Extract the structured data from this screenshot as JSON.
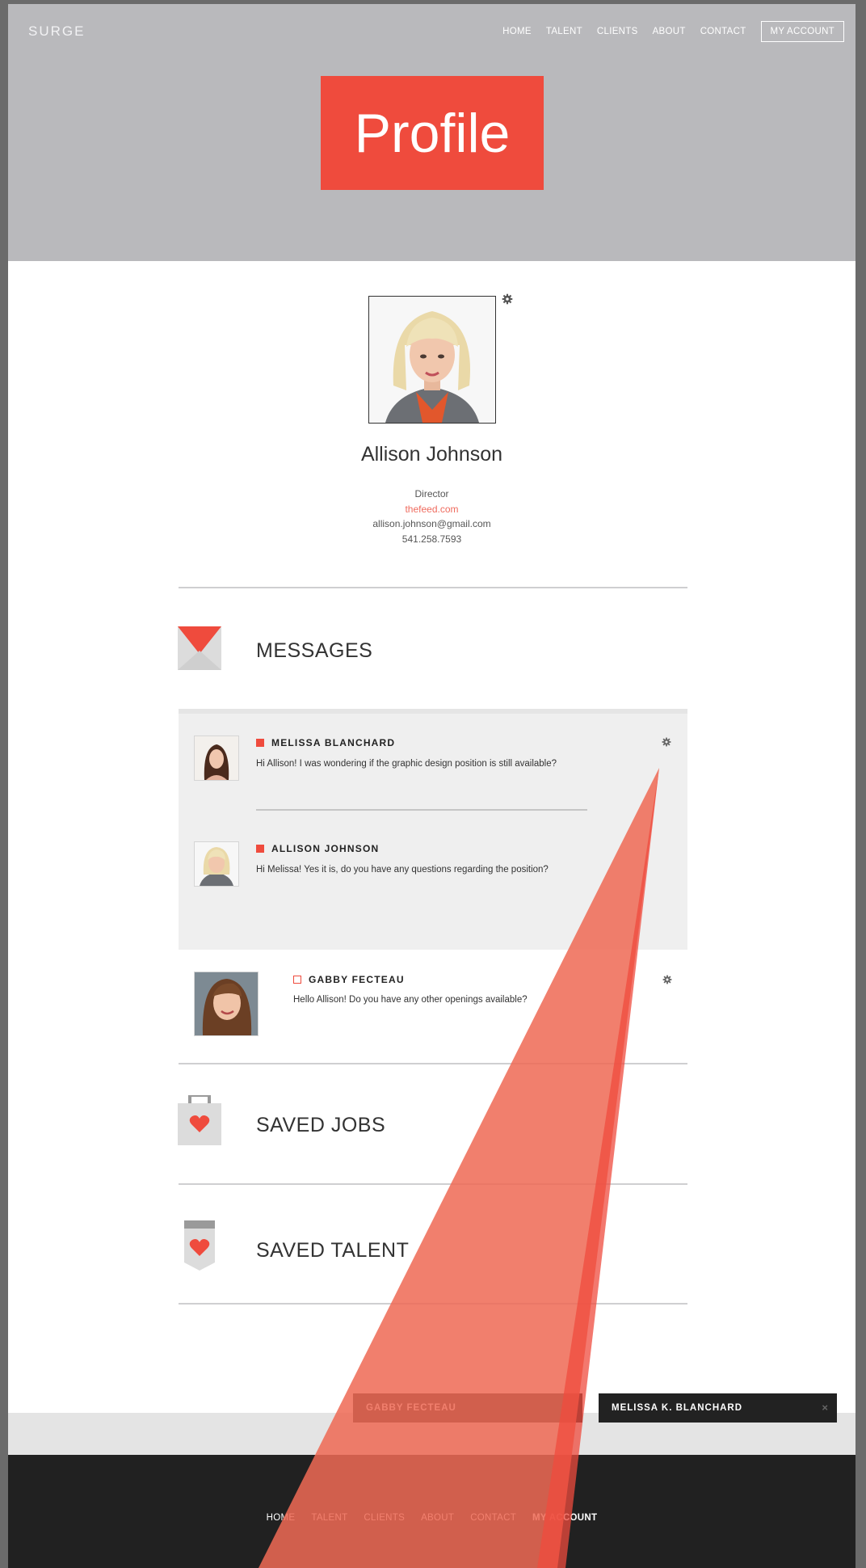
{
  "brand": "SURGE",
  "nav": {
    "items": [
      {
        "label": "HOME"
      },
      {
        "label": "TALENT"
      },
      {
        "label": "CLIENTS"
      },
      {
        "label": "ABOUT"
      },
      {
        "label": "CONTACT"
      }
    ],
    "account": "MY ACCOUNT"
  },
  "banner": "Profile",
  "profile": {
    "name": "Allison Johnson",
    "title": "Director",
    "website": "thefeed.com",
    "email": "allison.johnson@gmail.com",
    "phone": "541.258.7593"
  },
  "sections": {
    "messages": "MESSAGES",
    "saved_jobs": "SAVED JOBS",
    "saved_talent": "SAVED TALENT"
  },
  "messages": {
    "thread1": {
      "first": {
        "sender": "MELISSA BLANCHARD",
        "text": "Hi Allison! I was wondering if the graphic design position is still available?"
      },
      "reply": {
        "sender": "ALLISON JOHNSON",
        "text": "Hi Melissa! Yes it is, do you have any questions regarding the position?"
      }
    },
    "thread2": {
      "sender": "GABBY FECTEAU",
      "text": "Hello Allison! Do you have any other openings available?"
    }
  },
  "chat": {
    "tab1": "GABBY FECTEAU",
    "tab2": "MELISSA K. BLANCHARD",
    "close": "×"
  },
  "footer": {
    "items": [
      {
        "label": "HOME"
      },
      {
        "label": "TALENT"
      },
      {
        "label": "CLIENTS"
      },
      {
        "label": "ABOUT"
      },
      {
        "label": "CONTACT"
      }
    ],
    "account": "MY ACCOUNT"
  },
  "colors": {
    "accent": "#ef4b3d",
    "header_bg": "#b9b9bc",
    "footer_bg": "#212121",
    "thread_bg": "#efefef"
  }
}
